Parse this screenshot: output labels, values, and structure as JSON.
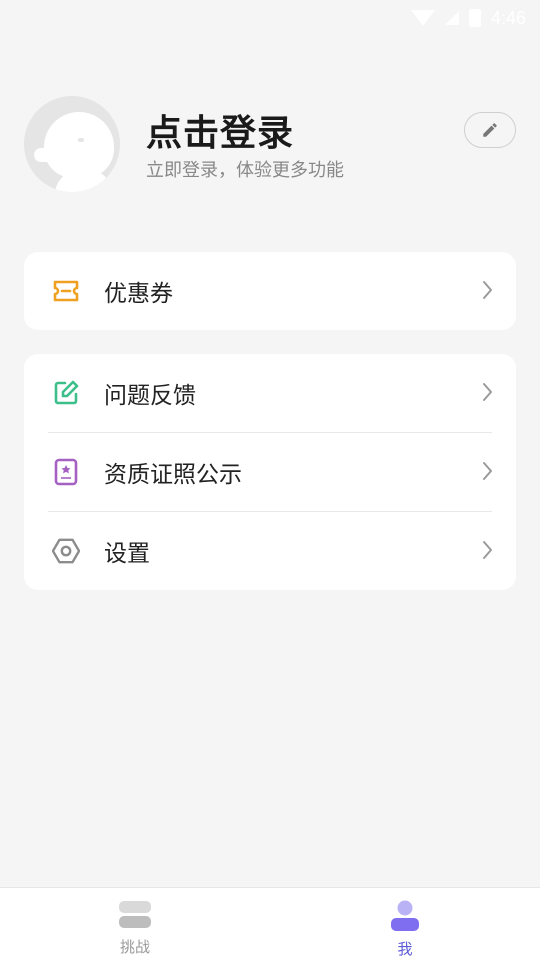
{
  "status_bar": {
    "time": "4:46"
  },
  "profile": {
    "title": "点击登录",
    "subtitle": "立即登录，体验更多功能"
  },
  "menu_group_1": [
    {
      "label": "优惠券",
      "icon": "coupon-icon",
      "color": "#f0a020"
    }
  ],
  "menu_group_2": [
    {
      "label": "问题反馈",
      "icon": "edit-feedback-icon",
      "color": "#3cbf8a"
    },
    {
      "label": "资质证照公示",
      "icon": "certificate-icon",
      "color": "#a561c2"
    },
    {
      "label": "设置",
      "icon": "settings-icon",
      "color": "#8c8c8c"
    }
  ],
  "tabbar": {
    "tabs": [
      {
        "label": "挑战",
        "icon": "challenge-icon"
      },
      {
        "label": "我",
        "icon": "profile-icon"
      }
    ],
    "active": "我",
    "active_color": "#5b5bd6",
    "inactive_color": "#999999"
  }
}
